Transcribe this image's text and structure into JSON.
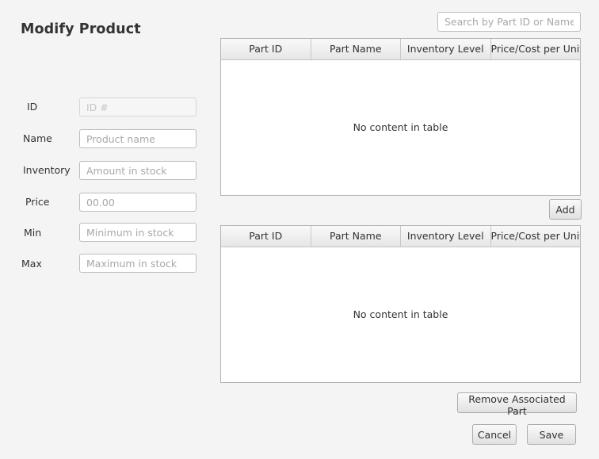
{
  "window": {
    "title": "Modify Product"
  },
  "form": {
    "fields": [
      {
        "label": "ID",
        "placeholder": "ID #",
        "value": ""
      },
      {
        "label": "Name",
        "placeholder": "Product name",
        "value": ""
      },
      {
        "label": "Inventory",
        "placeholder": "Amount in stock",
        "value": ""
      },
      {
        "label": "Price",
        "placeholder": "00.00",
        "value": ""
      },
      {
        "label": "Min",
        "placeholder": "Minimum in stock",
        "value": ""
      },
      {
        "label": "Max",
        "placeholder": "Maximum in stock",
        "value": ""
      }
    ]
  },
  "search": {
    "placeholder": "Search by Part ID or Name",
    "value": ""
  },
  "parts_table": {
    "columns": [
      "Part ID",
      "Part Name",
      "Inventory Level",
      "Price/Cost per Unit"
    ],
    "rows": [],
    "empty_text": "No content in table"
  },
  "associated_table": {
    "columns": [
      "Part ID",
      "Part Name",
      "Inventory Level",
      "Price/Cost per Unit"
    ],
    "rows": [],
    "empty_text": "No content in table"
  },
  "buttons": {
    "add": "Add",
    "remove": "Remove Associated Part",
    "cancel": "Cancel",
    "save": "Save"
  }
}
